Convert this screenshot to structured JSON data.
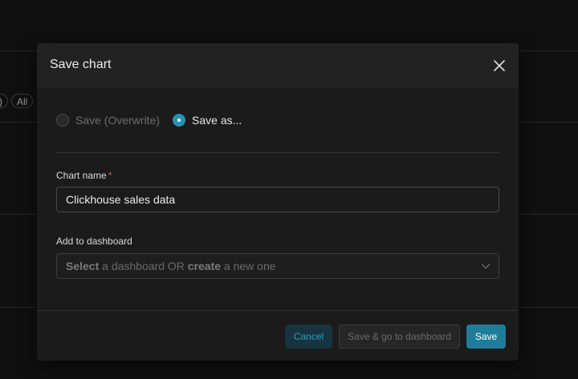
{
  "background": {
    "chips": [
      ")",
      "All"
    ]
  },
  "modal": {
    "title": "Save chart",
    "close_icon": "close-icon",
    "radios": [
      {
        "label": "Save (Overwrite)",
        "selected": false
      },
      {
        "label": "Save as...",
        "selected": true
      }
    ],
    "chart_name": {
      "label": "Chart name",
      "required_mark": "*",
      "value": "Clickhouse sales data"
    },
    "dashboard": {
      "label": "Add to dashboard",
      "placeholder_select": "Select",
      "placeholder_mid": " a dashboard OR ",
      "placeholder_create": "create",
      "placeholder_end": " a new one",
      "chevron_icon": "chevron-down-icon"
    },
    "footer": {
      "cancel_label": "Cancel",
      "save_go_label": "Save & go to dashboard",
      "save_label": "Save"
    }
  },
  "colors": {
    "accent": "#2893b3",
    "save_button": "#1f7d9b",
    "cancel_text": "#2e9ec0",
    "required": "#e05a5a"
  }
}
